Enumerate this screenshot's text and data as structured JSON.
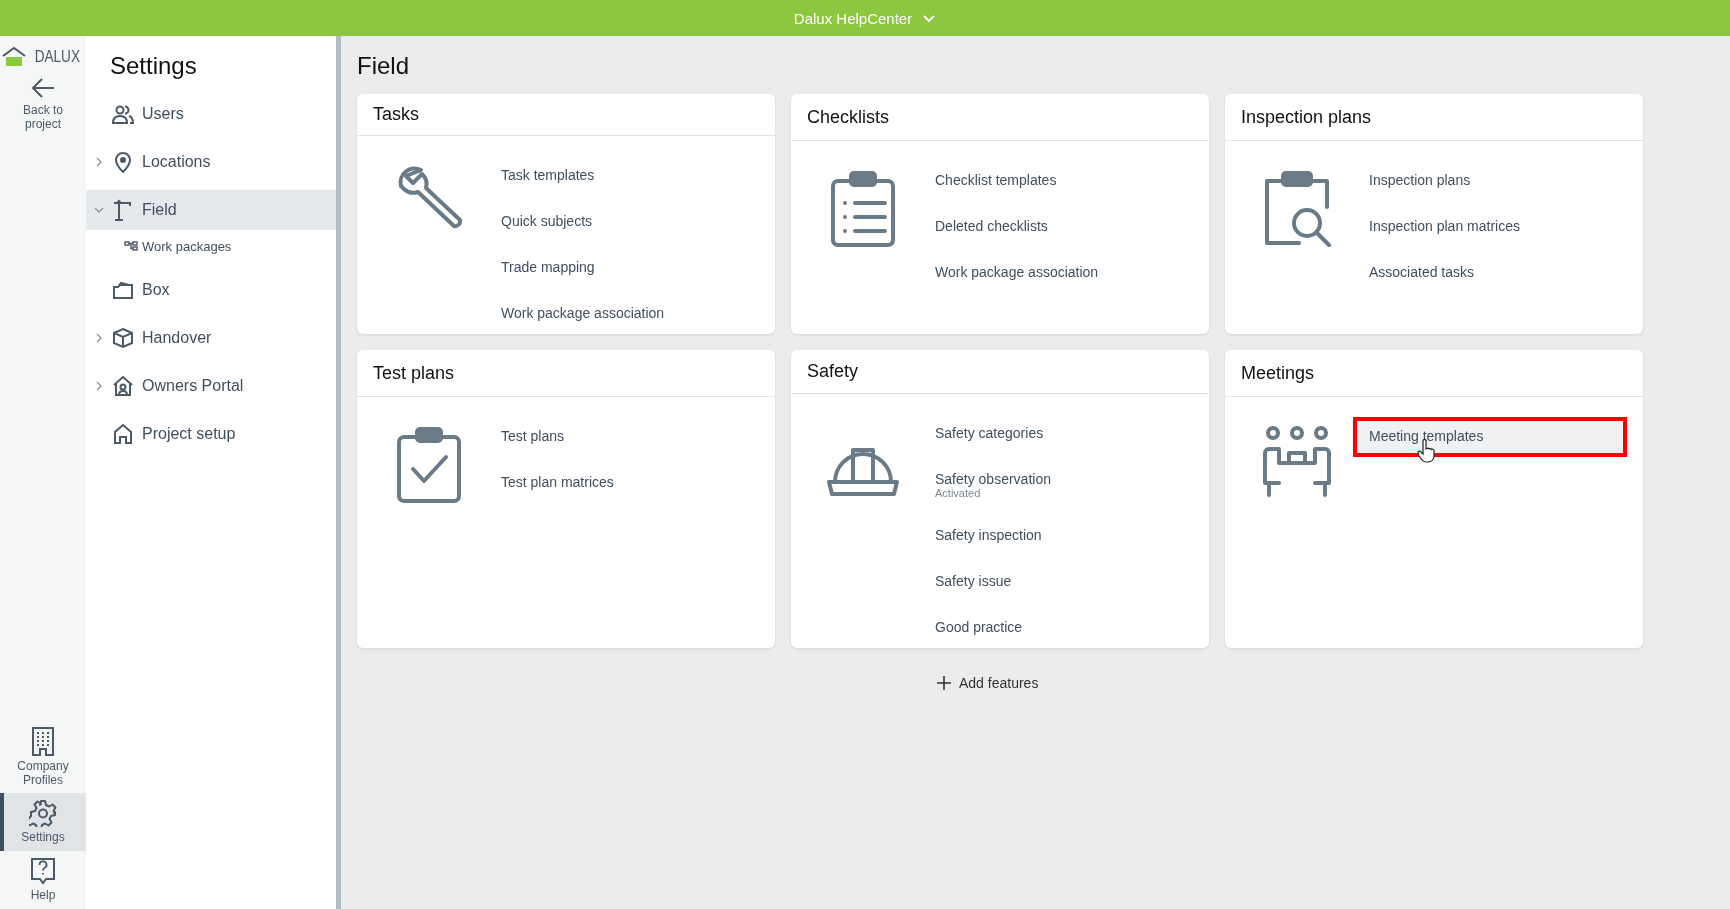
{
  "top_bar": {
    "title": "Dalux HelpCenter"
  },
  "rail": {
    "logo": "DALUX",
    "back": "Back to project",
    "items": [
      {
        "label": "Company Profiles",
        "selected": false
      },
      {
        "label": "Settings",
        "selected": true
      },
      {
        "label": "Help",
        "selected": false
      }
    ]
  },
  "sidebar": {
    "title": "Settings",
    "items": [
      {
        "label": "Users",
        "expandable": false,
        "selected": false
      },
      {
        "label": "Locations",
        "expandable": true,
        "expanded": false,
        "selected": false
      },
      {
        "label": "Field",
        "expandable": true,
        "expanded": true,
        "selected": true,
        "children": [
          {
            "label": "Work packages"
          }
        ]
      },
      {
        "label": "Box",
        "expandable": false,
        "selected": false
      },
      {
        "label": "Handover",
        "expandable": true,
        "expanded": false,
        "selected": false
      },
      {
        "label": "Owners Portal",
        "expandable": true,
        "expanded": false,
        "selected": false
      },
      {
        "label": "Project setup",
        "expandable": false,
        "selected": false
      }
    ]
  },
  "page": {
    "title": "Field",
    "cards": [
      {
        "title": "Tasks",
        "links": [
          {
            "label": "Task templates",
            "highlighted": false
          },
          {
            "label": "Quick subjects",
            "highlighted": false
          },
          {
            "label": "Trade mapping",
            "highlighted": false
          },
          {
            "label": "Work package association",
            "highlighted": false
          }
        ]
      },
      {
        "title": "Checklists",
        "links": [
          {
            "label": "Checklist templates",
            "highlighted": false
          },
          {
            "label": "Deleted checklists",
            "highlighted": false
          },
          {
            "label": "Work package association",
            "highlighted": false
          }
        ]
      },
      {
        "title": "Inspection plans",
        "links": [
          {
            "label": "Inspection plans",
            "highlighted": false
          },
          {
            "label": "Inspection plan matrices",
            "highlighted": false
          },
          {
            "label": "Associated tasks",
            "highlighted": false
          }
        ]
      },
      {
        "title": "Test plans",
        "links": [
          {
            "label": "Test plans",
            "highlighted": false
          },
          {
            "label": "Test plan matrices",
            "highlighted": false
          }
        ]
      },
      {
        "title": "Safety",
        "links": [
          {
            "label": "Safety categories",
            "highlighted": false
          },
          {
            "label": "Safety observation",
            "status": "Activated",
            "highlighted": false
          },
          {
            "label": "Safety inspection",
            "highlighted": false
          },
          {
            "label": "Safety issue",
            "highlighted": false
          },
          {
            "label": "Good practice",
            "highlighted": false
          }
        ]
      },
      {
        "title": "Meetings",
        "links": [
          {
            "label": "Meeting templates",
            "highlighted": true
          }
        ]
      }
    ],
    "add_button": "Add features"
  }
}
